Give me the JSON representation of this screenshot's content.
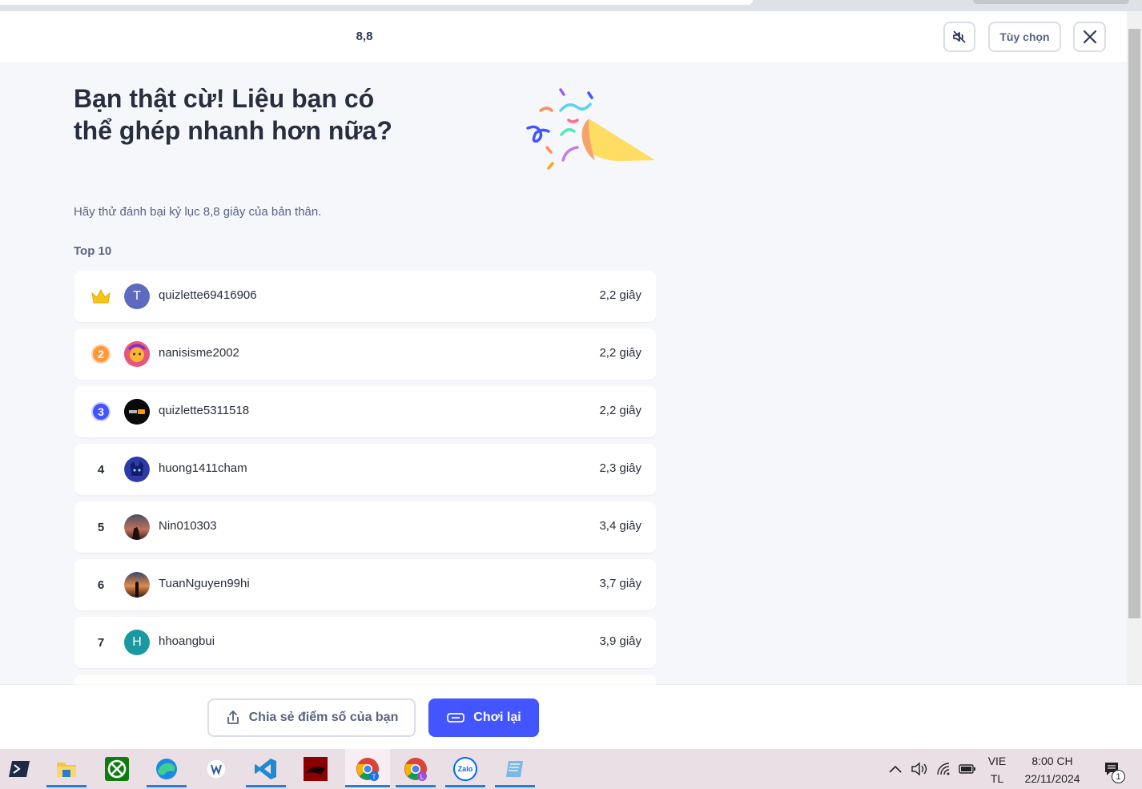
{
  "header": {
    "timer": "8,8",
    "options_label": "Tùy chọn"
  },
  "result": {
    "title": "Bạn thật cừ! Liệu bạn có thể ghép nhanh hơn nữa?",
    "subtitle": "Hãy thử đánh bại kỷ lục 8,8 giây của bản thân."
  },
  "leaderboard": {
    "label": "Top 10",
    "rows": [
      {
        "rank": "1",
        "avatar_letter": "T",
        "avatar_color": "#5c6bc0",
        "name": "quizlette69416906",
        "time": "2,2 giây"
      },
      {
        "rank": "2",
        "avatar_letter": "",
        "avatar_color": "#e85c84",
        "name": "nanisisme2002",
        "time": "2,2 giây"
      },
      {
        "rank": "3",
        "avatar_letter": "",
        "avatar_color": "#000000",
        "name": "quizlette5311518",
        "time": "2,2 giây"
      },
      {
        "rank": "4",
        "avatar_letter": "",
        "avatar_color": "#2f3aa8",
        "name": "huong1411cham",
        "time": "2,3 giây"
      },
      {
        "rank": "5",
        "avatar_letter": "",
        "avatar_color": "#7a4a3a",
        "name": "Nin010303",
        "time": "3,4 giây"
      },
      {
        "rank": "6",
        "avatar_letter": "",
        "avatar_color": "#c2633a",
        "name": "TuanNguyen99hi",
        "time": "3,7 giây"
      },
      {
        "rank": "7",
        "avatar_letter": "H",
        "avatar_color": "#1a9aa0",
        "name": "hhoangbui",
        "time": "3,9 giây"
      }
    ]
  },
  "actions": {
    "share_label": "Chia sẻ điểm số của bạn",
    "replay_label": "Chơi lại"
  },
  "colors": {
    "primary": "#4255ff",
    "gold": "#f5c518",
    "silver_orange": "#ff983a",
    "bronze_blue": "#4255ff"
  },
  "taskbar": {
    "apps": [
      "powershell-icon",
      "file-explorer-icon",
      "xbox-icon",
      "edge-icon",
      "word-app-icon",
      "vscode-icon",
      "game-app-icon",
      "chrome-icon",
      "chrome-profile-icon",
      "zalo-icon",
      "notepad-icon"
    ],
    "zalo_label": "Zalo",
    "lang_line1": "VIE",
    "lang_line2": "TL",
    "time": "8:00 CH",
    "date": "22/11/2024",
    "notification_count": "1"
  }
}
